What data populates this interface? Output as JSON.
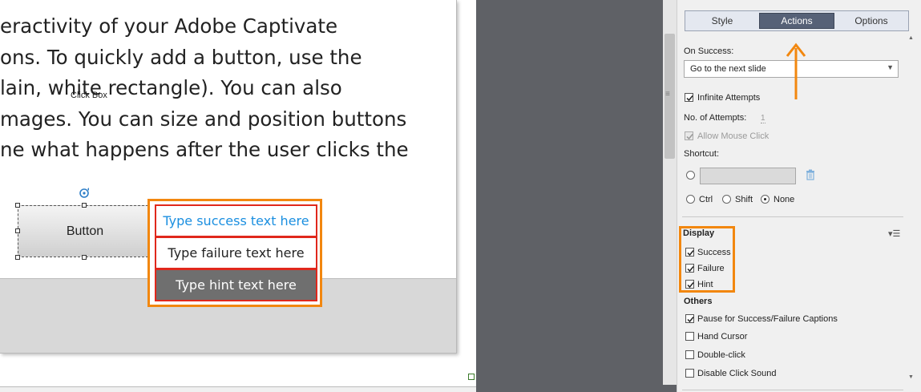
{
  "slide": {
    "body_lines": [
      "eractivity of your Adobe Captivate",
      "ons. To quickly add a button, use the",
      "lain, white rectangle). You can also",
      "mages. You can size and position buttons",
      "ne what happens after the user clicks the"
    ],
    "clickbox_label": "Click Box",
    "button_label": "Button",
    "captions": {
      "success": "Type success text here",
      "failure": "Type failure text here",
      "hint": "Type hint text here"
    }
  },
  "panel": {
    "tabs": [
      {
        "label": "Style",
        "active": false
      },
      {
        "label": "Actions",
        "active": true
      },
      {
        "label": "Options",
        "active": false
      }
    ],
    "on_success_label": "On Success:",
    "on_success_value": "Go to the next slide",
    "infinite_attempts": "Infinite Attempts",
    "no_of_attempts_label": "No. of Attempts:",
    "no_of_attempts_value": "1",
    "allow_mouse_click": "Allow Mouse Click",
    "shortcut_label": "Shortcut:",
    "modifiers": [
      "Ctrl",
      "Shift",
      "None"
    ],
    "display_heading": "Display",
    "display_items": [
      "Success",
      "Failure",
      "Hint"
    ],
    "others_heading": "Others",
    "others_items": [
      {
        "label": "Pause for Success/Failure Captions",
        "checked": true
      },
      {
        "label": "Hand Cursor",
        "checked": false
      },
      {
        "label": "Double-click",
        "checked": false
      },
      {
        "label": "Disable Click Sound",
        "checked": false
      }
    ]
  },
  "colors": {
    "highlight": "#f2870f",
    "caption_border": "#e0281c",
    "success_text": "#1b8fe0",
    "active_tab": "#566177"
  }
}
